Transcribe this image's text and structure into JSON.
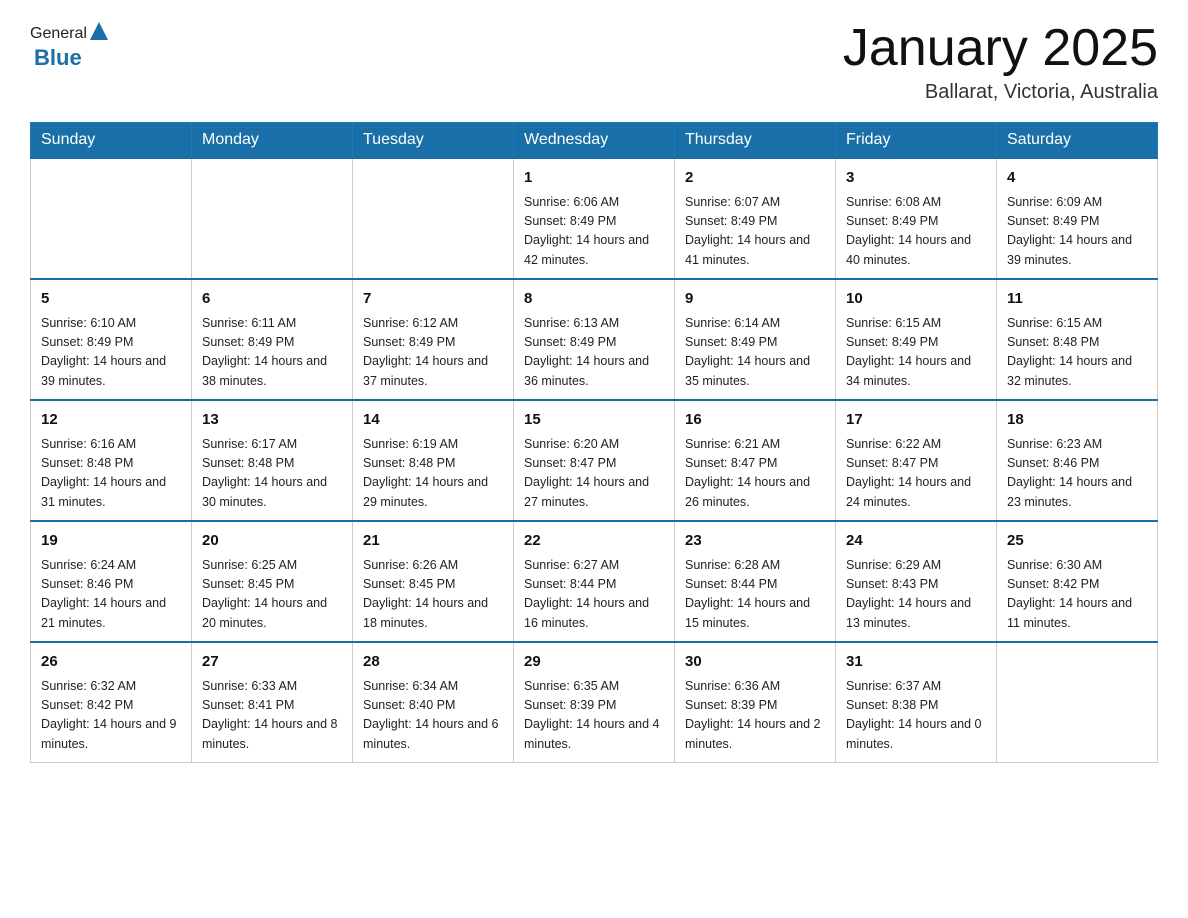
{
  "header": {
    "logo": {
      "general": "General",
      "blue": "Blue"
    },
    "title": "January 2025",
    "location": "Ballarat, Victoria, Australia"
  },
  "calendar": {
    "days": [
      "Sunday",
      "Monday",
      "Tuesday",
      "Wednesday",
      "Thursday",
      "Friday",
      "Saturday"
    ],
    "weeks": [
      [
        {
          "number": "",
          "info": ""
        },
        {
          "number": "",
          "info": ""
        },
        {
          "number": "",
          "info": ""
        },
        {
          "number": "1",
          "info": "Sunrise: 6:06 AM\nSunset: 8:49 PM\nDaylight: 14 hours\nand 42 minutes."
        },
        {
          "number": "2",
          "info": "Sunrise: 6:07 AM\nSunset: 8:49 PM\nDaylight: 14 hours\nand 41 minutes."
        },
        {
          "number": "3",
          "info": "Sunrise: 6:08 AM\nSunset: 8:49 PM\nDaylight: 14 hours\nand 40 minutes."
        },
        {
          "number": "4",
          "info": "Sunrise: 6:09 AM\nSunset: 8:49 PM\nDaylight: 14 hours\nand 39 minutes."
        }
      ],
      [
        {
          "number": "5",
          "info": "Sunrise: 6:10 AM\nSunset: 8:49 PM\nDaylight: 14 hours\nand 39 minutes."
        },
        {
          "number": "6",
          "info": "Sunrise: 6:11 AM\nSunset: 8:49 PM\nDaylight: 14 hours\nand 38 minutes."
        },
        {
          "number": "7",
          "info": "Sunrise: 6:12 AM\nSunset: 8:49 PM\nDaylight: 14 hours\nand 37 minutes."
        },
        {
          "number": "8",
          "info": "Sunrise: 6:13 AM\nSunset: 8:49 PM\nDaylight: 14 hours\nand 36 minutes."
        },
        {
          "number": "9",
          "info": "Sunrise: 6:14 AM\nSunset: 8:49 PM\nDaylight: 14 hours\nand 35 minutes."
        },
        {
          "number": "10",
          "info": "Sunrise: 6:15 AM\nSunset: 8:49 PM\nDaylight: 14 hours\nand 34 minutes."
        },
        {
          "number": "11",
          "info": "Sunrise: 6:15 AM\nSunset: 8:48 PM\nDaylight: 14 hours\nand 32 minutes."
        }
      ],
      [
        {
          "number": "12",
          "info": "Sunrise: 6:16 AM\nSunset: 8:48 PM\nDaylight: 14 hours\nand 31 minutes."
        },
        {
          "number": "13",
          "info": "Sunrise: 6:17 AM\nSunset: 8:48 PM\nDaylight: 14 hours\nand 30 minutes."
        },
        {
          "number": "14",
          "info": "Sunrise: 6:19 AM\nSunset: 8:48 PM\nDaylight: 14 hours\nand 29 minutes."
        },
        {
          "number": "15",
          "info": "Sunrise: 6:20 AM\nSunset: 8:47 PM\nDaylight: 14 hours\nand 27 minutes."
        },
        {
          "number": "16",
          "info": "Sunrise: 6:21 AM\nSunset: 8:47 PM\nDaylight: 14 hours\nand 26 minutes."
        },
        {
          "number": "17",
          "info": "Sunrise: 6:22 AM\nSunset: 8:47 PM\nDaylight: 14 hours\nand 24 minutes."
        },
        {
          "number": "18",
          "info": "Sunrise: 6:23 AM\nSunset: 8:46 PM\nDaylight: 14 hours\nand 23 minutes."
        }
      ],
      [
        {
          "number": "19",
          "info": "Sunrise: 6:24 AM\nSunset: 8:46 PM\nDaylight: 14 hours\nand 21 minutes."
        },
        {
          "number": "20",
          "info": "Sunrise: 6:25 AM\nSunset: 8:45 PM\nDaylight: 14 hours\nand 20 minutes."
        },
        {
          "number": "21",
          "info": "Sunrise: 6:26 AM\nSunset: 8:45 PM\nDaylight: 14 hours\nand 18 minutes."
        },
        {
          "number": "22",
          "info": "Sunrise: 6:27 AM\nSunset: 8:44 PM\nDaylight: 14 hours\nand 16 minutes."
        },
        {
          "number": "23",
          "info": "Sunrise: 6:28 AM\nSunset: 8:44 PM\nDaylight: 14 hours\nand 15 minutes."
        },
        {
          "number": "24",
          "info": "Sunrise: 6:29 AM\nSunset: 8:43 PM\nDaylight: 14 hours\nand 13 minutes."
        },
        {
          "number": "25",
          "info": "Sunrise: 6:30 AM\nSunset: 8:42 PM\nDaylight: 14 hours\nand 11 minutes."
        }
      ],
      [
        {
          "number": "26",
          "info": "Sunrise: 6:32 AM\nSunset: 8:42 PM\nDaylight: 14 hours\nand 9 minutes."
        },
        {
          "number": "27",
          "info": "Sunrise: 6:33 AM\nSunset: 8:41 PM\nDaylight: 14 hours\nand 8 minutes."
        },
        {
          "number": "28",
          "info": "Sunrise: 6:34 AM\nSunset: 8:40 PM\nDaylight: 14 hours\nand 6 minutes."
        },
        {
          "number": "29",
          "info": "Sunrise: 6:35 AM\nSunset: 8:39 PM\nDaylight: 14 hours\nand 4 minutes."
        },
        {
          "number": "30",
          "info": "Sunrise: 6:36 AM\nSunset: 8:39 PM\nDaylight: 14 hours\nand 2 minutes."
        },
        {
          "number": "31",
          "info": "Sunrise: 6:37 AM\nSunset: 8:38 PM\nDaylight: 14 hours\nand 0 minutes."
        },
        {
          "number": "",
          "info": ""
        }
      ]
    ]
  }
}
